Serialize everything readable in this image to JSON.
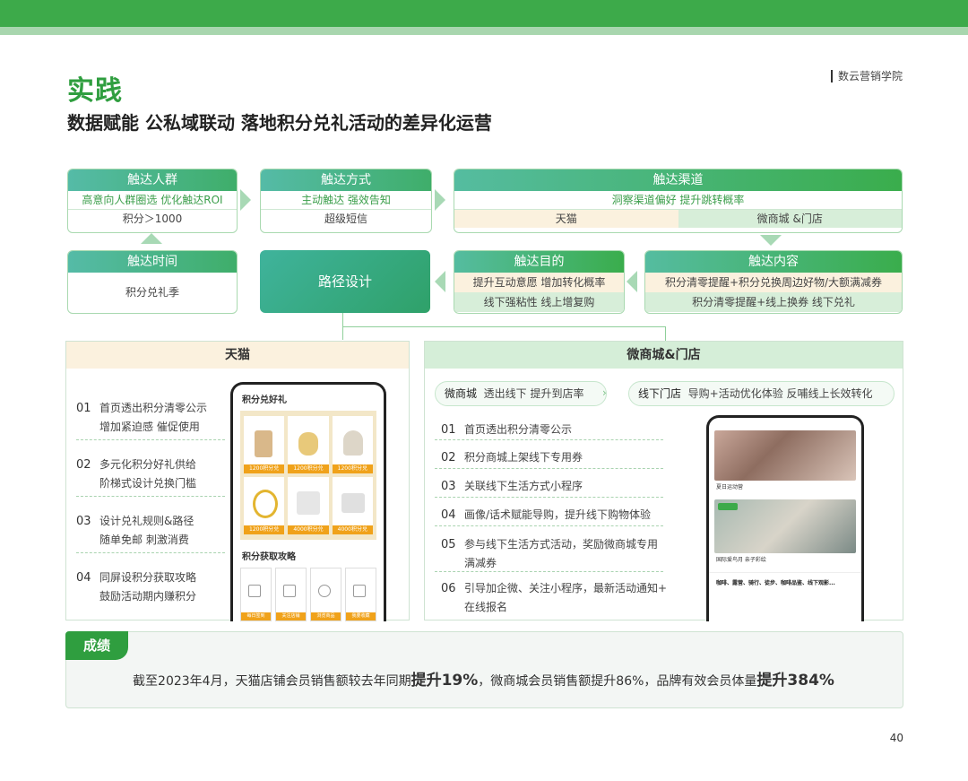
{
  "header": {
    "title": "实践",
    "subtitle": "数据赋能 公私域联动 落地积分兑礼活动的差异化运营",
    "brand": "数云营销学院",
    "page": "40"
  },
  "flow": {
    "audience": {
      "title": "触达人群",
      "line1": "高意向人群圈选 优化触达ROI",
      "line2": "积分＞1000"
    },
    "method": {
      "title": "触达方式",
      "line1": "主动触达 强效告知",
      "line2": "超级短信"
    },
    "channel": {
      "title": "触达渠道",
      "line1": "洞察渠道偏好 提升跳转概率",
      "left": "天猫",
      "right": "微商城 &门店"
    },
    "time": {
      "title": "触达时间",
      "line1": "积分兑礼季"
    },
    "path": {
      "title": "路径设计"
    },
    "goal": {
      "title": "触达目的",
      "line1": "提升互动意愿 增加转化概率",
      "line2": "线下强粘性 线上增复购"
    },
    "content": {
      "title": "触达内容",
      "line1": "积分清零提醒+积分兑换周边好物/大额满减券",
      "line2": "积分清零提醒+线上换券 线下兑礼"
    }
  },
  "tmall": {
    "title": "天猫",
    "items": [
      {
        "num": "01",
        "l1": "首页透出积分清零公示",
        "l2": "增加紧迫感 催促使用"
      },
      {
        "num": "02",
        "l1": "多元化积分好礼供给",
        "l2": "阶梯式设计兑换门槛"
      },
      {
        "num": "03",
        "l1": "设计兑礼规则&路径",
        "l2": "随单免邮 刺激消费"
      },
      {
        "num": "04",
        "l1": "同屏设积分获取攻略",
        "l2": "鼓励活动期内赚积分"
      }
    ],
    "phone": {
      "title": "积分兑好礼",
      "tiles": [
        "1200积分兑",
        "1200积分兑",
        "1200积分兑",
        "1200积分兑",
        "4000积分兑",
        "4000积分兑"
      ],
      "section": "积分获取攻略",
      "tasks": [
        "每日签到",
        "关注店铺",
        "浏览商品",
        "我要收藏"
      ]
    }
  },
  "wsc": {
    "title": "微商城&门店",
    "pill1": {
      "label": "微商城",
      "text": "透出线下 提升到店率"
    },
    "pill2": {
      "label": "线下门店",
      "text": "导购+活动优化体验 反哺线上长效转化"
    },
    "items": [
      {
        "num": "01",
        "l1": "首页透出积分清零公示",
        "l2": ""
      },
      {
        "num": "02",
        "l1": "积分商城上架线下专用券",
        "l2": ""
      },
      {
        "num": "03",
        "l1": "关联线下生活方式小程序",
        "l2": ""
      },
      {
        "num": "04",
        "l1": "画像/话术赋能导购，提升线下购物体验",
        "l2": ""
      },
      {
        "num": "05",
        "l1": "参与线下生活方式活动，奖励微商城专用",
        "l2": "满减券"
      },
      {
        "num": "06",
        "l1": "引导加企微、关注小程序，最新活动通知+",
        "l2": "在线报名"
      }
    ],
    "phone": {
      "cap1": "夏日运动营",
      "cap2": "国际爱鸟月 亲子彩绘",
      "footer": "咖啡、露营、骑行、徒步、咖啡品鉴、线下观影..."
    }
  },
  "result": {
    "label": "成绩",
    "t1": "截至2023年4月，天猫店铺会员销售额较去年同期",
    "b1": "提升19%",
    "t2": "，微商城会员销售额提升86%，品牌有效会员体量",
    "b2": "提升384%"
  },
  "colors": {
    "primary": "#2f9e3f",
    "teal": "#3fb39c"
  }
}
